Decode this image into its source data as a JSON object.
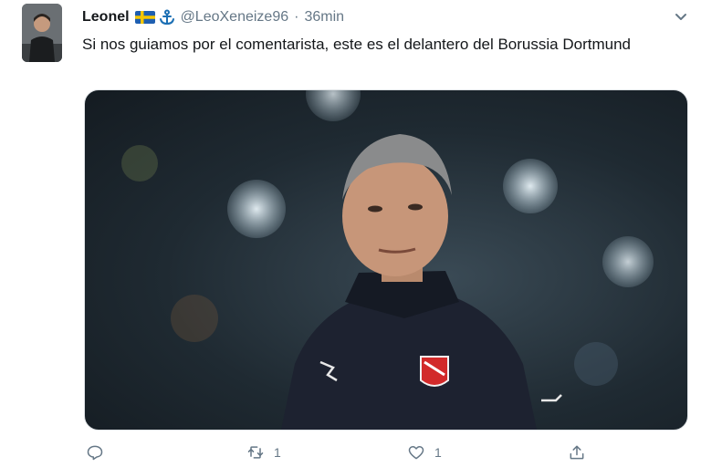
{
  "tweet": {
    "author": {
      "display_name": "Leonel",
      "handle": "@LeoXeneize96",
      "separator": "·",
      "time": "36min",
      "avatar": "user-avatar-photo",
      "badges": [
        "sweden-flag-icon",
        "anchor-icon"
      ]
    },
    "text": "Si nos guiamos por el comentarista, este es el delantero del Borussia Dortmund",
    "media": {
      "description_icon": "photo-coach-image"
    },
    "actions": {
      "reply_count": "",
      "retweet_count": "1",
      "like_count": "1",
      "share_count": ""
    }
  },
  "colors": {
    "text_primary": "#14171a",
    "text_secondary": "#657786",
    "flag_blue": "#1f5fb0",
    "flag_yellow": "#f6c700",
    "anchor_blue": "#1b6fb4"
  }
}
